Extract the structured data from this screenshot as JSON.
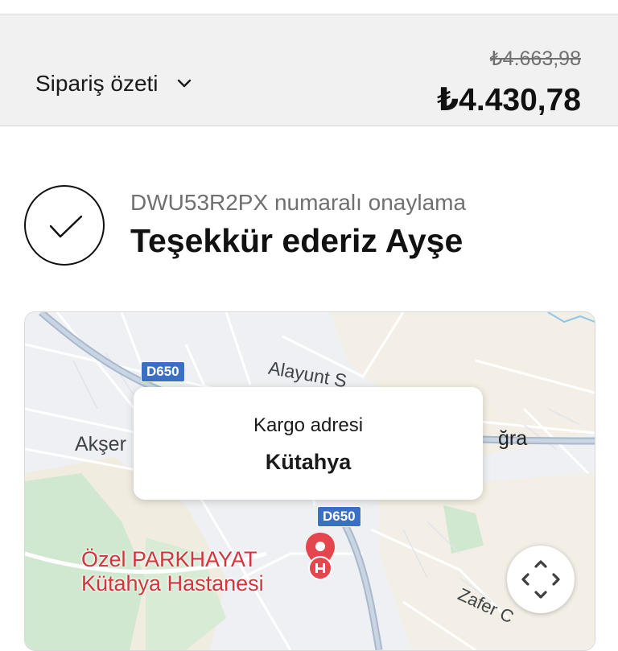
{
  "summary": {
    "toggle_label": "Sipariş özeti",
    "original_price": "₺4.663,98",
    "total_price": "₺4.430,78"
  },
  "confirmation": {
    "subtitle": "DWU53R2PX numaralı onaylama",
    "title": "Teşekkür ederiz Ayşe"
  },
  "map": {
    "road_badges": [
      "D650",
      "D650"
    ],
    "labels": {
      "street_alayunt": "Alayunt S",
      "place_akser": "Akşer",
      "place_gra": "ğra",
      "street_zafer": "Zafer C"
    },
    "poi": {
      "line1": "Özel PARKHAYAT",
      "line2": "Kütahya Hastanesi"
    },
    "popup": {
      "label": "Kargo adresi",
      "value": "Kütahya"
    }
  },
  "colors": {
    "accent_pin": "#e5464d",
    "road_badge": "#3b6fc4",
    "summary_bg": "#f1f1f1"
  }
}
